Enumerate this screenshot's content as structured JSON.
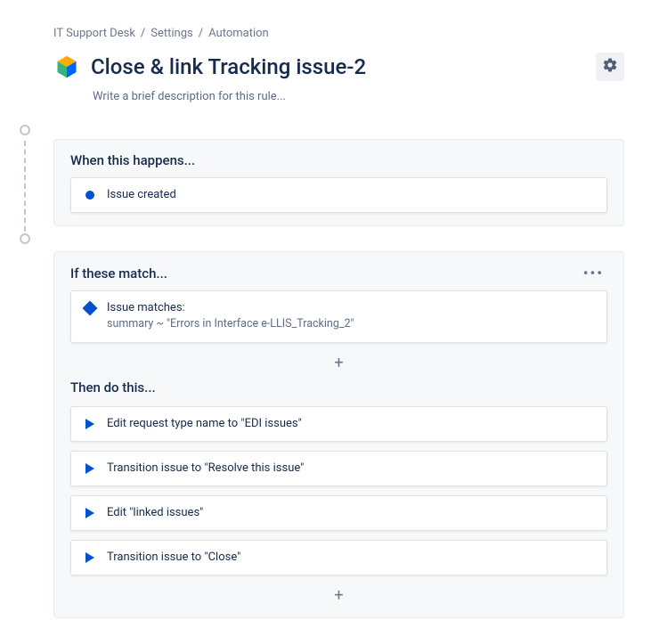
{
  "breadcrumb": {
    "item1": "IT Support Desk",
    "item2": "Settings",
    "item3": "Automation",
    "sep": "/"
  },
  "title": "Close & link Tracking issue-2",
  "description": "Write a brief description for this rule...",
  "when": {
    "title": "When this happens...",
    "trigger": "Issue created"
  },
  "if": {
    "title": "If these match...",
    "cond_label": "Issue matches:",
    "cond_detail": "summary ~ \"Errors in Interface e-LLIS_Tracking_2\"",
    "add": "+"
  },
  "then": {
    "title": "Then do this...",
    "action1": "Edit request type name to \"EDI issues\"",
    "action2": "Transition issue to \"Resolve this issue\"",
    "action3": "Edit \"linked issues\"",
    "action4": "Transition issue to \"Close\"",
    "add": "+"
  },
  "more_glyph": "•••"
}
